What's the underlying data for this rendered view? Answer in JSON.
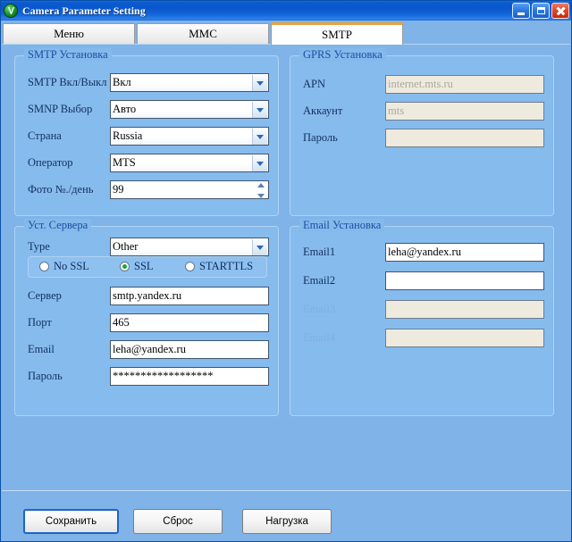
{
  "window": {
    "title": "Camera Parameter Setting",
    "icon": "app-icon",
    "controls": {
      "minimize": "minimize-button",
      "maximize": "maximize-button",
      "close": "close-button"
    }
  },
  "tabs": [
    {
      "label": "Меню",
      "active": false
    },
    {
      "label": "MMC",
      "active": false
    },
    {
      "label": "SMTP",
      "active": true
    }
  ],
  "groups": {
    "smtp_setup": {
      "title": "SMTP Установка",
      "fields": [
        {
          "label": "SMTP Вкл/Выкл",
          "value": "Вкл",
          "type": "combo",
          "disabled": false
        },
        {
          "label": "SMNP Выбор",
          "value": "Авто",
          "type": "combo",
          "disabled": false
        },
        {
          "label": "Страна",
          "value": "Russia",
          "type": "combo",
          "disabled": false
        },
        {
          "label": "Оператор",
          "value": "MTS",
          "type": "combo",
          "disabled": false
        },
        {
          "label": "Фото №./день",
          "value": "99",
          "type": "spinner",
          "disabled": false
        }
      ]
    },
    "gprs_setup": {
      "title": "GPRS Установка",
      "fields": [
        {
          "label": "APN",
          "value": "internet.mts.ru",
          "type": "text",
          "disabled": true
        },
        {
          "label": "Аккаунт",
          "value": "mts",
          "type": "text",
          "disabled": true
        },
        {
          "label": "Пароль",
          "value": "",
          "type": "text",
          "disabled": true
        }
      ]
    },
    "server_setup": {
      "title": "Уст. Сервера",
      "type_field": {
        "label": "Type",
        "value": "Other",
        "type": "combo"
      },
      "ssl_options": [
        {
          "label": "No SSL",
          "selected": false
        },
        {
          "label": "SSL",
          "selected": true
        },
        {
          "label": "STARTTLS",
          "selected": false
        }
      ],
      "fields": [
        {
          "label": "Сервер",
          "value": "smtp.yandex.ru",
          "type": "text",
          "disabled": false
        },
        {
          "label": "Порт",
          "value": "465",
          "type": "text",
          "disabled": false
        },
        {
          "label": "Email",
          "value": "leha@yandex.ru",
          "type": "text",
          "disabled": false
        },
        {
          "label": "Пароль",
          "value": "******************",
          "type": "text",
          "disabled": false
        }
      ]
    },
    "email_setup": {
      "title": "Email Установка",
      "fields": [
        {
          "label": "Email1",
          "value": "leha@yandex.ru",
          "type": "text",
          "disabled": false
        },
        {
          "label": "Email2",
          "value": "",
          "type": "text",
          "disabled": false
        },
        {
          "label": "Email3",
          "value": "",
          "type": "text",
          "disabled": true
        },
        {
          "label": "Email4",
          "value": "",
          "type": "text",
          "disabled": true
        }
      ]
    }
  },
  "buttons": {
    "save": "Сохранить",
    "reset": "Сброс",
    "load": "Нагрузка"
  },
  "colors": {
    "background": "#80b3e8",
    "group_fill": "#86bbee",
    "group_border": "#aed3f2",
    "group_title": "#1c4fa0",
    "titlebar": "#0a58cc",
    "active_tab_accent": "#e8a33d",
    "radio_selected": "#15a82a",
    "disabled_field": "#eeeade",
    "focus_border": "#1f63c4"
  }
}
